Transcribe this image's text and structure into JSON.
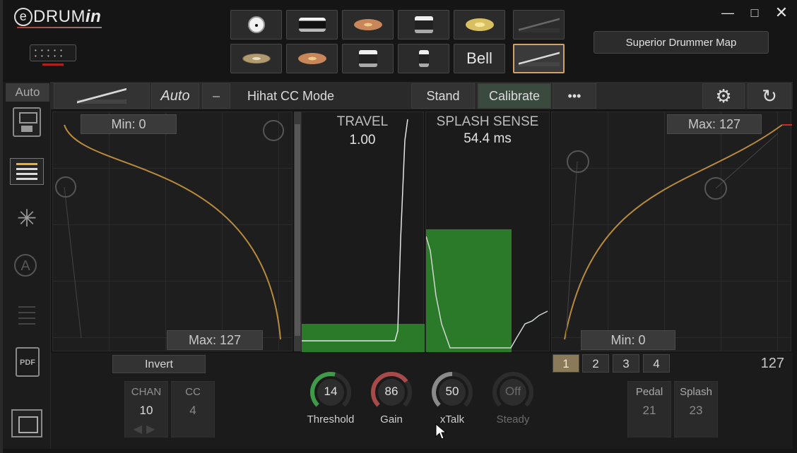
{
  "app": {
    "logo_text": "DRUM",
    "logo_e": "e",
    "logo_in": "in"
  },
  "top": {
    "bell_label": "Bell",
    "superior_drummer_map": "Superior Drummer Map"
  },
  "sidebar": {
    "auto_label": "Auto"
  },
  "toolbar": {
    "auto_label": "Auto",
    "hihat_mode": "Hihat CC Mode",
    "stand_label": "Stand",
    "calibrate_label": "Calibrate"
  },
  "left_curve": {
    "min_label": "Min: 0",
    "max_label": "Max: 127"
  },
  "travel": {
    "label": "TRAVEL",
    "value": "1.00"
  },
  "splash_sense": {
    "label": "SPLASH SENSE",
    "value": "54.4 ms"
  },
  "right_curve": {
    "max_label": "Max: 127",
    "min_label": "Min: 0"
  },
  "bottom": {
    "invert_label": "Invert",
    "chan_header": "CHAN",
    "chan_value": "10",
    "cc_header": "CC",
    "cc_value": "4",
    "knobs": [
      {
        "label": "Threshold",
        "value": "14",
        "color": "#3f9a4a",
        "level": 0.55
      },
      {
        "label": "Gain",
        "value": "86",
        "color": "#a84a4a",
        "level": 0.7
      },
      {
        "label": "xTalk",
        "value": "50",
        "color": "#8a8a8a",
        "level": 0.5
      },
      {
        "label": "Steady",
        "value": "Off",
        "color": "#3a3a3a",
        "level": 0.0
      }
    ],
    "pages": [
      "1",
      "2",
      "3",
      "4"
    ],
    "value_127": "127",
    "pedal_header": "Pedal",
    "pedal_value": "21",
    "splash_header": "Splash",
    "splash_value": "23"
  }
}
